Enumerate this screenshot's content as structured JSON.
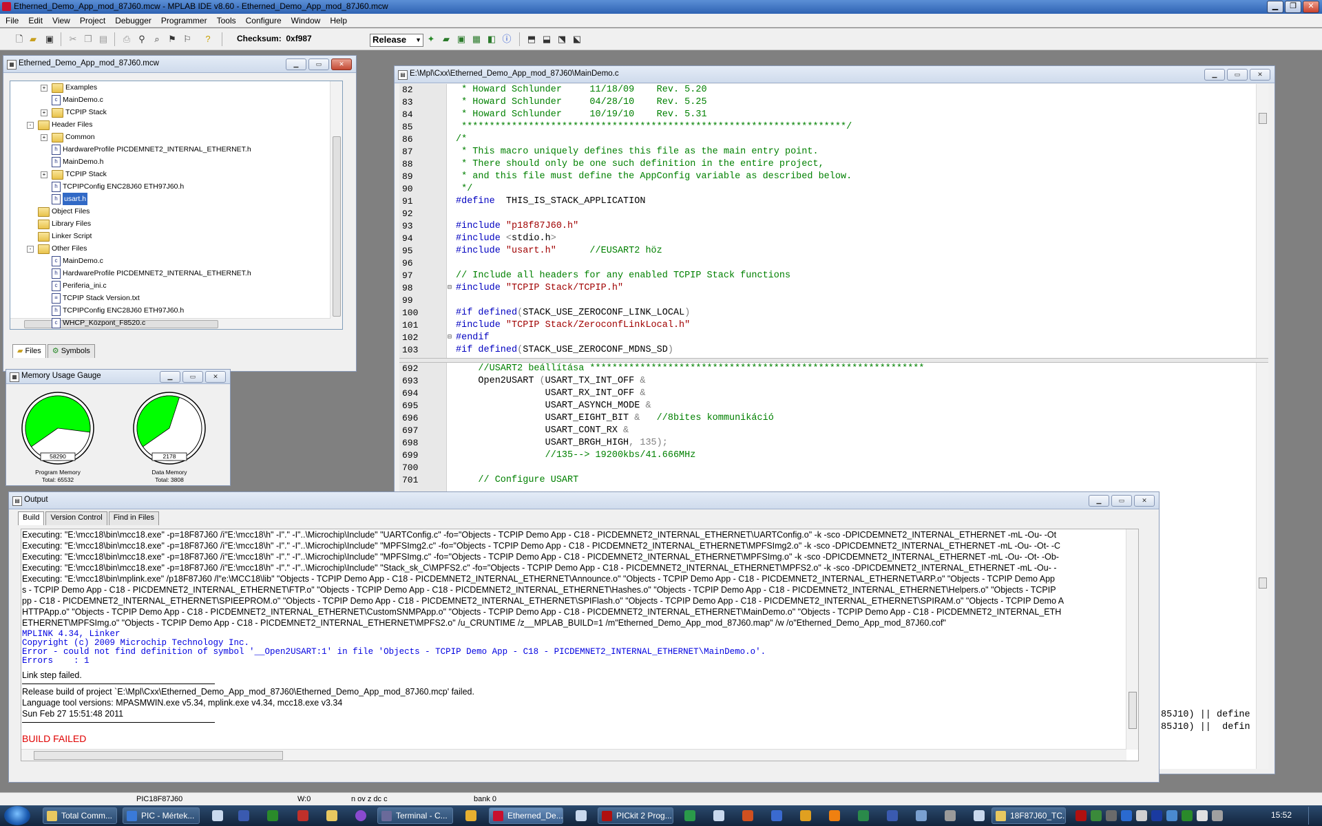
{
  "window": {
    "title": "Etherned_Demo_App_mod_87J60.mcw - MPLAB IDE v8.60 - Etherned_Demo_App_mod_87J60.mcw"
  },
  "menu": [
    "File",
    "Edit",
    "View",
    "Project",
    "Debugger",
    "Programmer",
    "Tools",
    "Configure",
    "Window",
    "Help"
  ],
  "toolbar": {
    "checksum_label": "Checksum:",
    "checksum_value": "0xf987",
    "config": "Release"
  },
  "project": {
    "title": "Etherned_Demo_App_mod_87J60.mcw",
    "tabs": [
      "Files",
      "Symbols"
    ],
    "items": [
      {
        "label": "Examples",
        "kind": "folder",
        "level": 2,
        "exp": "+"
      },
      {
        "label": "MainDemo.c",
        "kind": "c",
        "level": 2
      },
      {
        "label": "TCPIP Stack",
        "kind": "folder",
        "level": 2,
        "exp": "+"
      },
      {
        "label": "Header Files",
        "kind": "folder",
        "level": 1,
        "exp": "-"
      },
      {
        "label": "Common",
        "kind": "folder",
        "level": 2,
        "exp": "+"
      },
      {
        "label": "HardwareProfile PICDEMNET2_INTERNAL_ETHERNET.h",
        "kind": "h",
        "level": 2
      },
      {
        "label": "MainDemo.h",
        "kind": "h",
        "level": 2
      },
      {
        "label": "TCPIP Stack",
        "kind": "folder",
        "level": 2,
        "exp": "+"
      },
      {
        "label": "TCPIPConfig ENC28J60 ETH97J60.h",
        "kind": "h",
        "level": 2
      },
      {
        "label": "usart.h",
        "kind": "h",
        "level": 2,
        "selected": true
      },
      {
        "label": "Object Files",
        "kind": "folder",
        "level": 1
      },
      {
        "label": "Library Files",
        "kind": "folder",
        "level": 1
      },
      {
        "label": "Linker Script",
        "kind": "folder",
        "level": 1
      },
      {
        "label": "Other Files",
        "kind": "folder",
        "level": 1,
        "exp": "-"
      },
      {
        "label": "MainDemo.c",
        "kind": "c",
        "level": 2
      },
      {
        "label": "HardwareProfile PICDEMNET2_INTERNAL_ETHERNET.h",
        "kind": "h",
        "level": 2
      },
      {
        "label": "Periferia_ini.c",
        "kind": "c",
        "level": 2
      },
      {
        "label": "TCPIP Stack Version.txt",
        "kind": "t",
        "level": 2
      },
      {
        "label": "TCPIPConfig ENC28J60 ETH97J60.h",
        "kind": "h",
        "level": 2
      },
      {
        "label": "WHCP_Központ_F8520.c",
        "kind": "c",
        "level": 2
      }
    ]
  },
  "gauge": {
    "title": "Memory Usage Gauge",
    "program": {
      "value": "58290",
      "label": "Program Memory",
      "total": "Total: 65532",
      "fraction": 0.889
    },
    "data": {
      "value": "2178",
      "label": "Data Memory",
      "total": "Total: 3808",
      "fraction": 0.572
    }
  },
  "editor": {
    "title": "E:\\Mpl\\Cxx\\Etherned_Demo_App_mod_87J60\\MainDemo.c",
    "top": [
      {
        "n": "82",
        "s": [
          [
            "cm",
            " * Howard Schlunder     11/18/09    Rev. 5.20"
          ]
        ]
      },
      {
        "n": "83",
        "s": [
          [
            "cm",
            " * Howard Schlunder     04/28/10    Rev. 5.25"
          ]
        ]
      },
      {
        "n": "84",
        "s": [
          [
            "cm",
            " * Howard Schlunder     10/19/10    Rev. 5.31"
          ]
        ]
      },
      {
        "n": "85",
        "s": [
          [
            "cm",
            " *********************************************************************/"
          ]
        ]
      },
      {
        "n": "86",
        "s": [
          [
            "cm",
            "/*"
          ]
        ]
      },
      {
        "n": "87",
        "s": [
          [
            "cm",
            " * This macro uniquely defines this file as the main entry point."
          ]
        ]
      },
      {
        "n": "88",
        "s": [
          [
            "cm",
            " * There should only be one such definition in the entire project,"
          ]
        ]
      },
      {
        "n": "89",
        "s": [
          [
            "cm",
            " * and this file must define the AppConfig variable as described below."
          ]
        ]
      },
      {
        "n": "90",
        "s": [
          [
            "cm",
            " */"
          ]
        ]
      },
      {
        "n": "91",
        "s": [
          [
            "pp",
            "#define"
          ],
          [
            "",
            "  THIS_IS_STACK_APPLICATION"
          ]
        ]
      },
      {
        "n": "92",
        "s": []
      },
      {
        "n": "93",
        "s": [
          [
            "pp",
            "#include"
          ],
          [
            "st",
            " \"p18f87J60.h\""
          ]
        ]
      },
      {
        "n": "94",
        "s": [
          [
            "pp",
            "#include"
          ],
          [
            "op",
            " <"
          ],
          [
            "",
            "stdio.h"
          ],
          [
            "op",
            ">"
          ]
        ]
      },
      {
        "n": "95",
        "s": [
          [
            "pp",
            "#include"
          ],
          [
            "st",
            " \"usart.h\""
          ],
          [
            "cm",
            "      //EUSART2 höz"
          ]
        ]
      },
      {
        "n": "96",
        "s": []
      },
      {
        "n": "97",
        "s": [
          [
            "cm",
            "// Include all headers for any enabled TCPIP Stack functions"
          ]
        ]
      },
      {
        "n": "98",
        "s": [
          [
            "pp",
            "#include"
          ],
          [
            "st",
            " \"TCPIP Stack/TCPIP.h\""
          ]
        ],
        "fold": true
      },
      {
        "n": "99",
        "s": []
      },
      {
        "n": "100",
        "s": [
          [
            "pp",
            "#if defined"
          ],
          [
            "op",
            "("
          ],
          [
            "",
            "STACK_USE_ZEROCONF_LINK_LOCAL"
          ],
          [
            "op",
            ")"
          ]
        ]
      },
      {
        "n": "101",
        "s": [
          [
            "pp",
            "#include"
          ],
          [
            "st",
            " \"TCPIP Stack/ZeroconfLinkLocal.h\""
          ]
        ]
      },
      {
        "n": "102",
        "s": [
          [
            "pp",
            "#endif"
          ]
        ],
        "fold": true
      },
      {
        "n": "103",
        "s": [
          [
            "pp",
            "#if defined"
          ],
          [
            "op",
            "("
          ],
          [
            "",
            "STACK_USE_ZEROCONF_MDNS_SD"
          ],
          [
            "op",
            ")"
          ]
        ]
      }
    ],
    "bottom": [
      {
        "n": "692",
        "s": [
          [
            "cm",
            "    //USART2 beállítása ************************************************************"
          ]
        ]
      },
      {
        "n": "693",
        "s": [
          [
            "",
            "    Open2USART "
          ],
          [
            "op",
            "("
          ],
          [
            "",
            "USART_TX_INT_OFF "
          ],
          [
            "op",
            "&"
          ]
        ]
      },
      {
        "n": "694",
        "s": [
          [
            "",
            "                USART_RX_INT_OFF "
          ],
          [
            "op",
            "&"
          ]
        ]
      },
      {
        "n": "695",
        "s": [
          [
            "",
            "                USART_ASYNCH_MODE "
          ],
          [
            "op",
            "&"
          ]
        ]
      },
      {
        "n": "696",
        "s": [
          [
            "",
            "                USART_EIGHT_BIT "
          ],
          [
            "op",
            "&"
          ],
          [
            "cm",
            "   //8bites kommunikáció"
          ]
        ]
      },
      {
        "n": "697",
        "s": [
          [
            "",
            "                USART_CONT_RX "
          ],
          [
            "op",
            "&"
          ]
        ]
      },
      {
        "n": "698",
        "s": [
          [
            "",
            "                USART_BRGH_HIGH"
          ],
          [
            "op",
            ", 135);"
          ]
        ]
      },
      {
        "n": "699",
        "s": [
          [
            "cm",
            "                //135--> 19200kbs/41.666MHz"
          ]
        ]
      },
      {
        "n": "700",
        "s": []
      },
      {
        "n": "701",
        "s": [
          [
            "cm",
            "    // Configure USART"
          ]
        ]
      }
    ],
    "peek": [
      "85J10) || define",
      "85J10) ||  defin"
    ]
  },
  "output": {
    "title": "Output",
    "tabs": [
      "Build",
      "Version Control",
      "Find in Files"
    ],
    "lines": [
      {
        "k": "n",
        "t": "Executing: \"E:\\mcc18\\bin\\mcc18.exe\" -p=18F87J60 /i\"E:\\mcc18\\h\" -I\".\" -I\"..\\Microchip\\Include\" \"UARTConfig.c\" -fo=\"Objects - TCPIP Demo App - C18 - PICDEMNET2_INTERNAL_ETHERNET\\UARTConfig.o\" -k -sco -DPICDEMNET2_INTERNAL_ETHERNET -mL -Ou- -Ot"
      },
      {
        "k": "n",
        "t": "Executing: \"E:\\mcc18\\bin\\mcc18.exe\" -p=18F87J60 /i\"E:\\mcc18\\h\" -I\".\" -I\"..\\Microchip\\Include\" \"MPFSImg2.c\" -fo=\"Objects - TCPIP Demo App - C18 - PICDEMNET2_INTERNAL_ETHERNET\\MPFSImg2.o\" -k -sco -DPICDEMNET2_INTERNAL_ETHERNET -mL -Ou- -Ot- -C"
      },
      {
        "k": "n",
        "t": "Executing: \"E:\\mcc18\\bin\\mcc18.exe\" -p=18F87J60 /i\"E:\\mcc18\\h\" -I\".\" -I\"..\\Microchip\\Include\" \"MPFSImg.c\" -fo=\"Objects - TCPIP Demo App - C18 - PICDEMNET2_INTERNAL_ETHERNET\\MPFSImg.o\" -k -sco -DPICDEMNET2_INTERNAL_ETHERNET -mL -Ou- -Ot- -Ob-"
      },
      {
        "k": "n",
        "t": "Executing: \"E:\\mcc18\\bin\\mcc18.exe\" -p=18F87J60 /i\"E:\\mcc18\\h\" -I\".\" -I\"..\\Microchip\\Include\" \"Stack_sk_C\\MPFS2.c\" -fo=\"Objects - TCPIP Demo App - C18 - PICDEMNET2_INTERNAL_ETHERNET\\MPFS2.o\" -k -sco -DPICDEMNET2_INTERNAL_ETHERNET -mL -Ou- -"
      },
      {
        "k": "n",
        "t": "Executing: \"E:\\mcc18\\bin\\mplink.exe\" /p18F87J60 /l\"e:\\MCC18\\lib\" \"Objects - TCPIP Demo App - C18 - PICDEMNET2_INTERNAL_ETHERNET\\Announce.o\" \"Objects - TCPIP Demo App - C18 - PICDEMNET2_INTERNAL_ETHERNET\\ARP.o\" \"Objects - TCPIP Demo App"
      },
      {
        "k": "n",
        "t": "s - TCPIP Demo App - C18 - PICDEMNET2_INTERNAL_ETHERNET\\FTP.o\" \"Objects - TCPIP Demo App - C18 - PICDEMNET2_INTERNAL_ETHERNET\\Hashes.o\" \"Objects - TCPIP Demo App - C18 - PICDEMNET2_INTERNAL_ETHERNET\\Helpers.o\" \"Objects - TCPIP"
      },
      {
        "k": "n",
        "t": "pp - C18 - PICDEMNET2_INTERNAL_ETHERNET\\SPIEEPROM.o\" \"Objects - TCPIP Demo App - C18 - PICDEMNET2_INTERNAL_ETHERNET\\SPIFlash.o\" \"Objects - TCPIP Demo App - C18 - PICDEMNET2_INTERNAL_ETHERNET\\SPIRAM.o\" \"Objects - TCPIP Demo A"
      },
      {
        "k": "n",
        "t": "HTTPApp.o\" \"Objects - TCPIP Demo App - C18 - PICDEMNET2_INTERNAL_ETHERNET\\CustomSNMPApp.o\" \"Objects - TCPIP Demo App - C18 - PICDEMNET2_INTERNAL_ETHERNET\\MainDemo.o\" \"Objects - TCPIP Demo App - C18 - PICDEMNET2_INTERNAL_ETH"
      },
      {
        "k": "n",
        "t": "ETHERNET\\MPFSImg.o\" \"Objects - TCPIP Demo App - C18 - PICDEMNET2_INTERNAL_ETHERNET\\MPFS2.o\" /u_CRUNTIME /z__MPLAB_BUILD=1 /m\"Etherned_Demo_App_mod_87J60.map\" /w /o\"Etherned_Demo_App_mod_87J60.cof\""
      },
      {
        "k": "m",
        "t": "MPLINK 4.34, Linker"
      },
      {
        "k": "m",
        "t": "Copyright (c) 2009 Microchip Technology Inc."
      },
      {
        "k": "m",
        "t": "Error - could not find definition of symbol '__Open2USART:1' in file 'Objects - TCPIP Demo App - C18 - PICDEMNET2_INTERNAL_ETHERNET\\MainDemo.o'."
      },
      {
        "k": "m",
        "t": "Errors    : 1"
      },
      {
        "k": "b",
        "t": ""
      },
      {
        "k": "n",
        "t": "Link step failed."
      },
      {
        "k": "r",
        "t": ""
      },
      {
        "k": "n",
        "t": "Release build of project `E:\\Mpl\\Cxx\\Etherned_Demo_App_mod_87J60\\Etherned_Demo_App_mod_87J60.mcp' failed."
      },
      {
        "k": "n",
        "t": "Language tool versions: MPASMWIN.exe v5.34, mplink.exe v4.34, mcc18.exe v3.34"
      },
      {
        "k": "n",
        "t": "Sun Feb 27 15:51:48 2011"
      },
      {
        "k": "r",
        "t": ""
      },
      {
        "k": "b",
        "t": ""
      },
      {
        "k": "f",
        "t": "BUILD FAILED"
      }
    ]
  },
  "status": {
    "device": "PIC18F87J60",
    "w": "W:0",
    "flags": "n ov z dc c",
    "bank": "bank 0"
  },
  "taskbar": {
    "items": [
      "Total Comm...",
      "PIC - Mértek...",
      "Terminal - C...",
      "Etherned_De...",
      "PICkit 2 Prog...",
      "18F87J60_TC..."
    ],
    "clock": "15:52"
  },
  "colors": {
    "accent": "#3169c6",
    "gauge_fill": "#00ff00",
    "error_red": "#e00000",
    "link_blue": "#0000e0"
  }
}
